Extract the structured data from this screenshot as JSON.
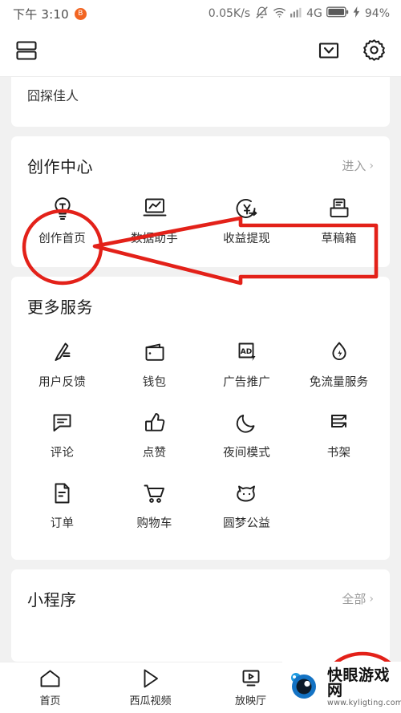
{
  "status_bar": {
    "time": "下午 3:10",
    "badge_glyph": "B",
    "network_speed": "0.05K/s",
    "network_type": "4G",
    "battery_percent": "94%",
    "icons": [
      "mute-bell-icon",
      "wifi-icon",
      "signal-bars-icon",
      "battery-icon",
      "charging-bolt-icon"
    ]
  },
  "header": {
    "split_screen_icon": "split-screen-icon",
    "inbox_icon": "inbox-icon",
    "settings_icon": "gear-icon"
  },
  "top_card": {
    "text": "囧探佳人"
  },
  "creation_center": {
    "title": "创作中心",
    "more_label": "进入",
    "chevron": "›",
    "items": [
      {
        "label": "创作首页",
        "icon": "lightbulb-icon"
      },
      {
        "label": "数据助手",
        "icon": "chart-monitor-icon"
      },
      {
        "label": "收益提现",
        "icon": "yuan-clock-arrow-icon"
      },
      {
        "label": "草稿箱",
        "icon": "draft-inbox-icon"
      }
    ]
  },
  "more_services": {
    "title": "更多服务",
    "items": [
      {
        "label": "用户反馈",
        "icon": "pencil-feedback-icon"
      },
      {
        "label": "钱包",
        "icon": "wallet-icon"
      },
      {
        "label": "广告推广",
        "icon": "ad-bolt-icon"
      },
      {
        "label": "免流量服务",
        "icon": "droplet-bolt-icon"
      },
      {
        "label": "评论",
        "icon": "comment-icon"
      },
      {
        "label": "点赞",
        "icon": "thumbs-up-icon"
      },
      {
        "label": "夜间模式",
        "icon": "moon-icon"
      },
      {
        "label": "书架",
        "icon": "bookshelf-icon"
      },
      {
        "label": "订单",
        "icon": "document-order-icon"
      },
      {
        "label": "购物车",
        "icon": "shopping-cart-icon"
      },
      {
        "label": "圆梦公益",
        "icon": "cat-charity-icon"
      }
    ]
  },
  "mini_programs": {
    "title": "小程序",
    "more_label": "全部",
    "chevron": "›"
  },
  "bottom_nav": {
    "items": [
      {
        "label": "首页",
        "icon": "home-icon"
      },
      {
        "label": "西瓜视频",
        "icon": "play-triangle-icon"
      },
      {
        "label": "放映厅",
        "icon": "screening-room-icon"
      }
    ]
  },
  "annotations": {
    "color": "#e32119",
    "shapes": [
      "ellipse-around-creation-home",
      "arrow-pointing-left",
      "partial-circle-bottom-right"
    ]
  },
  "watermark": {
    "site_name": "快眼游戏网",
    "url": "www.kyligting.com",
    "logo": "blue-eye-logo"
  }
}
